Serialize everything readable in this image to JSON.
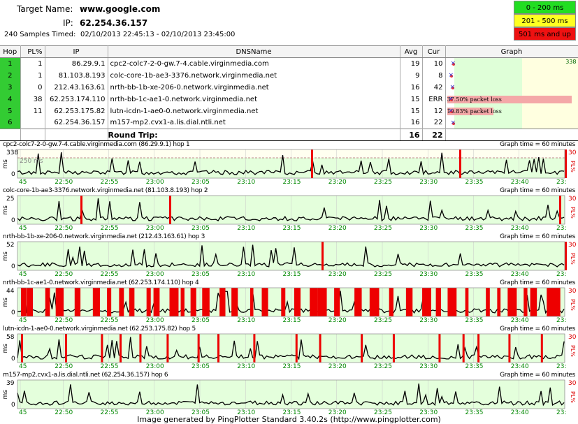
{
  "header": {
    "target_label": "Target Name:",
    "target_value": "www.google.com",
    "ip_label": "IP:",
    "ip_value": "62.254.36.157",
    "samples_label": "240 Samples Timed:",
    "samples_range": "02/10/2013 22:45:13 - 02/10/2013 23:45:00"
  },
  "legend": [
    {
      "label": "0 - 200 ms",
      "color": "#22dd22"
    },
    {
      "label": "201 - 500 ms",
      "color": "#ffff22"
    },
    {
      "label": "501 ms and up",
      "color": "#ee1111"
    }
  ],
  "table": {
    "columns": [
      "Hop",
      "PL%",
      "IP",
      "DNSName",
      "Avg",
      "Cur",
      "Graph"
    ],
    "graph_scale_max": "338",
    "rows": [
      {
        "hop": "1",
        "pl": "1",
        "ip": "86.29.9.1",
        "dns": "cpc2-colc7-2-0-gw.7-4.cable.virginmedia.com",
        "avg": "19",
        "cur": "10",
        "pl_bar": ""
      },
      {
        "hop": "2",
        "pl": "1",
        "ip": "81.103.8.193",
        "dns": "colc-core-1b-ae3-3376.network.virginmedia.net",
        "avg": "9",
        "cur": "8",
        "pl_bar": ""
      },
      {
        "hop": "3",
        "pl": "0",
        "ip": "212.43.163.61",
        "dns": "nrth-bb-1b-xe-206-0.network.virginmedia.net",
        "avg": "16",
        "cur": "42",
        "pl_bar": ""
      },
      {
        "hop": "4",
        "pl": "38",
        "ip": "62.253.174.110",
        "dns": "nrth-bb-1c-ae1-0.network.virginmedia.net",
        "avg": "15",
        "cur": "ERR",
        "pl_bar": "37.50% packet loss"
      },
      {
        "hop": "5",
        "pl": "11",
        "ip": "62.253.175.82",
        "dns": "lutn-icdn-1-ae0-0.network.virginmedia.net",
        "avg": "15",
        "cur": "12",
        "pl_bar": "10.83% packet loss"
      },
      {
        "hop": "6",
        "pl": "",
        "ip": "62.254.36.157",
        "dns": "m157-mp2.cvx1-a.lis.dial.ntli.net",
        "avg": "16",
        "cur": "22",
        "pl_bar": ""
      }
    ],
    "round_trip_label": "Round Trip:",
    "round_trip_avg": "16",
    "round_trip_cur": "22"
  },
  "graphs": [
    {
      "title": "cpc2-colc7-2-0-gw.7-4.cable.virginmedia.com (86.29.9.1) hop 1",
      "right": "Graph time = 60 minutes",
      "ymax": "338",
      "ylabel": "ms",
      "pl_label": "PL%",
      "pl_max": "30",
      "ref_label": "250 ms",
      "ref_value": 250,
      "scale": 338
    },
    {
      "title": "colc-core-1b-ae3-3376.network.virginmedia.net (81.103.8.193) hop 2",
      "right": "Graph time = 60 minutes",
      "ymax": "25",
      "ylabel": "ms",
      "pl_label": "PL%",
      "pl_max": "30",
      "scale": 25
    },
    {
      "title": "nrth-bb-1b-xe-206-0.network.virginmedia.net (212.43.163.61) hop 3",
      "right": "Graph time = 60 minutes",
      "ymax": "52",
      "ylabel": "ms",
      "pl_label": "PL%",
      "pl_max": "30",
      "scale": 52
    },
    {
      "title": "nrth-bb-1c-ae1-0.network.virginmedia.net (62.253.174.110) hop 4",
      "right": "Graph time = 60 minutes",
      "ymax": "44",
      "ylabel": "ms",
      "pl_label": "PL%",
      "pl_max": "30",
      "scale": 44
    },
    {
      "title": "lutn-icdn-1-ae0-0.network.virginmedia.net (62.253.175.82) hop 5",
      "right": "Graph time = 60 minutes",
      "ymax": "58",
      "ylabel": "ms",
      "pl_label": "PL%",
      "pl_max": "30",
      "scale": 58
    },
    {
      "title": "m157-mp2.cvx1-a.lis.dial.ntli.net (62.254.36.157) hop 6",
      "right": "Graph time = 60 minutes",
      "ymax": "39",
      "ylabel": "ms",
      "pl_label": "PL%",
      "pl_max": "30",
      "scale": 39
    }
  ],
  "time_ticks": [
    "45",
    "22:50",
    "22:55",
    "23:00",
    "23:05",
    "23:10",
    "23:15",
    "23:20",
    "23:25",
    "23:30",
    "23:35",
    "23:40",
    "23:"
  ],
  "footer": "Image generated by PingPlotter Standard 3.40.2s (http://www.pingplotter.com)"
}
